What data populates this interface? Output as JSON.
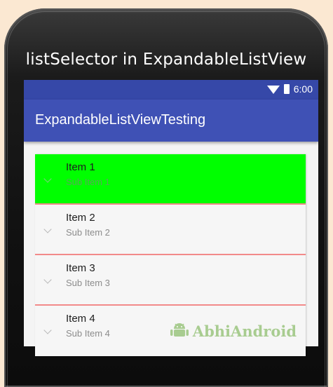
{
  "header": {
    "title": "listSelector in ExpandableListView"
  },
  "status_bar": {
    "time": "6:00",
    "icons": [
      "wifi-icon",
      "battery-icon"
    ]
  },
  "app_bar": {
    "title": "ExpandableListViewTesting",
    "color": "#3f51b5",
    "status_color": "#3648a8"
  },
  "list": {
    "selected_color": "#00ff00",
    "divider_color": "#f28a8a",
    "groups": [
      {
        "title": "Item 1",
        "subtitle": "Sub Item 1",
        "selected": true
      },
      {
        "title": "Item 2",
        "subtitle": "Sub Item 2",
        "selected": false
      },
      {
        "title": "Item 3",
        "subtitle": "Sub Item 3",
        "selected": false
      },
      {
        "title": "Item 4",
        "subtitle": "Sub Item 4",
        "selected": false
      }
    ]
  },
  "watermark": {
    "text": "AbhiAndroid",
    "icon": "android-logo-icon"
  }
}
